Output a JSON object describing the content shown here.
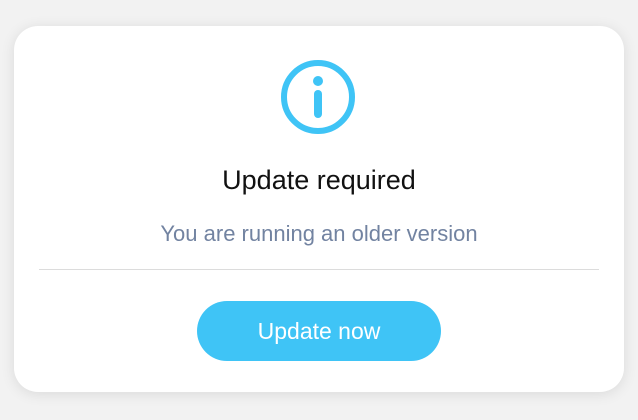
{
  "dialog": {
    "icon": "info-circle-icon",
    "title": "Update required",
    "message": "You are running an older version",
    "button_label": "Update now"
  },
  "colors": {
    "accent": "#3fc4f6",
    "title": "#111111",
    "message": "#7283a1",
    "divider": "#dcdcdc"
  }
}
